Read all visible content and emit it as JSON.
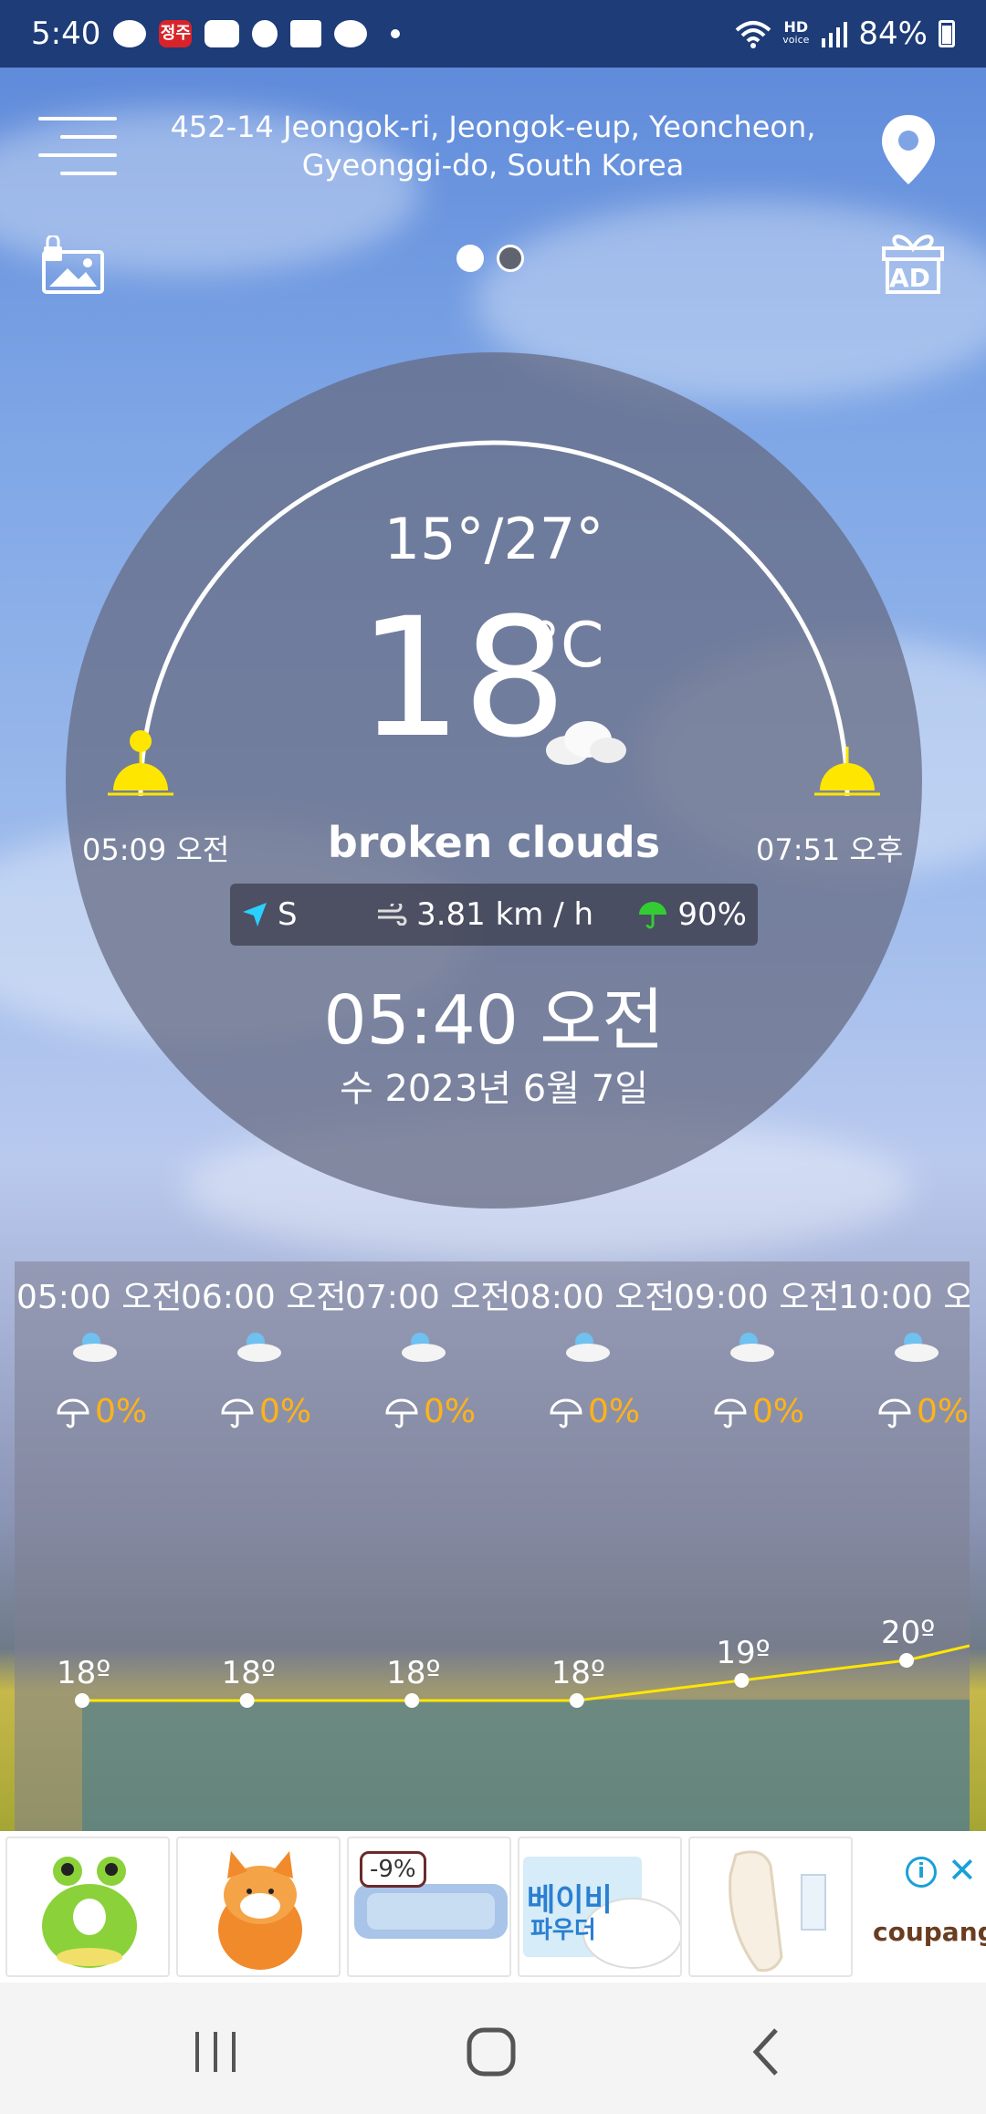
{
  "status_bar": {
    "time": "5:40",
    "battery": "84%",
    "hd_label": "HD",
    "hd_sub": "voice",
    "badge_text": "정주"
  },
  "header": {
    "address": "452-14 Jeongok-ri, Jeongok-eup, Yeoncheon, Gyeonggi-do, South Korea",
    "ad_label": "AD"
  },
  "weather": {
    "hi_lo": "15°/27°",
    "temperature": "18",
    "unit": "°C",
    "description": "broken clouds",
    "sunrise": "05:09 오전",
    "sunset": "07:51 오후",
    "wind_direction": "S",
    "wind_speed": "3.81 km / h",
    "humidity": "90%",
    "time": "05:40 오전",
    "date": "수 2023년 6월 7일"
  },
  "hourly": [
    {
      "time": "05:00 오전",
      "rain": "0%",
      "temp": "18º",
      "value": 18
    },
    {
      "time": "06:00 오전",
      "rain": "0%",
      "temp": "18º",
      "value": 18
    },
    {
      "time": "07:00 오전",
      "rain": "0%",
      "temp": "18º",
      "value": 18
    },
    {
      "time": "08:00 오전",
      "rain": "0%",
      "temp": "18º",
      "value": 18
    },
    {
      "time": "09:00 오전",
      "rain": "0%",
      "temp": "19º",
      "value": 19
    },
    {
      "time": "10:00 오",
      "rain": "0%",
      "temp": "20º",
      "value": 20
    }
  ],
  "ad": {
    "discount": "-9%",
    "brand": "coupang",
    "info": "i",
    "close": "✕",
    "product4_line1": "베이비",
    "product4_line2": "파우더"
  },
  "colors": {
    "status_bar": "#1d3c78",
    "accent_yellow": "#ffe600",
    "rain_orange": "#ffb317",
    "wind_cyan": "#2ad0ff",
    "umbrella_green": "#33cc33",
    "ad_blue": "#1aa0d8"
  },
  "icons": {
    "menu": "hamburger-icon",
    "location": "location-pin-icon",
    "wallpaper": "locked-image-icon",
    "gift": "gift-ad-icon",
    "sunrise": "sunrise-icon",
    "sunset": "sunset-icon",
    "cloud": "cloud-icon",
    "wind_direction": "navigation-arrow-icon",
    "wind": "wind-icon",
    "humidity": "umbrella-icon"
  }
}
